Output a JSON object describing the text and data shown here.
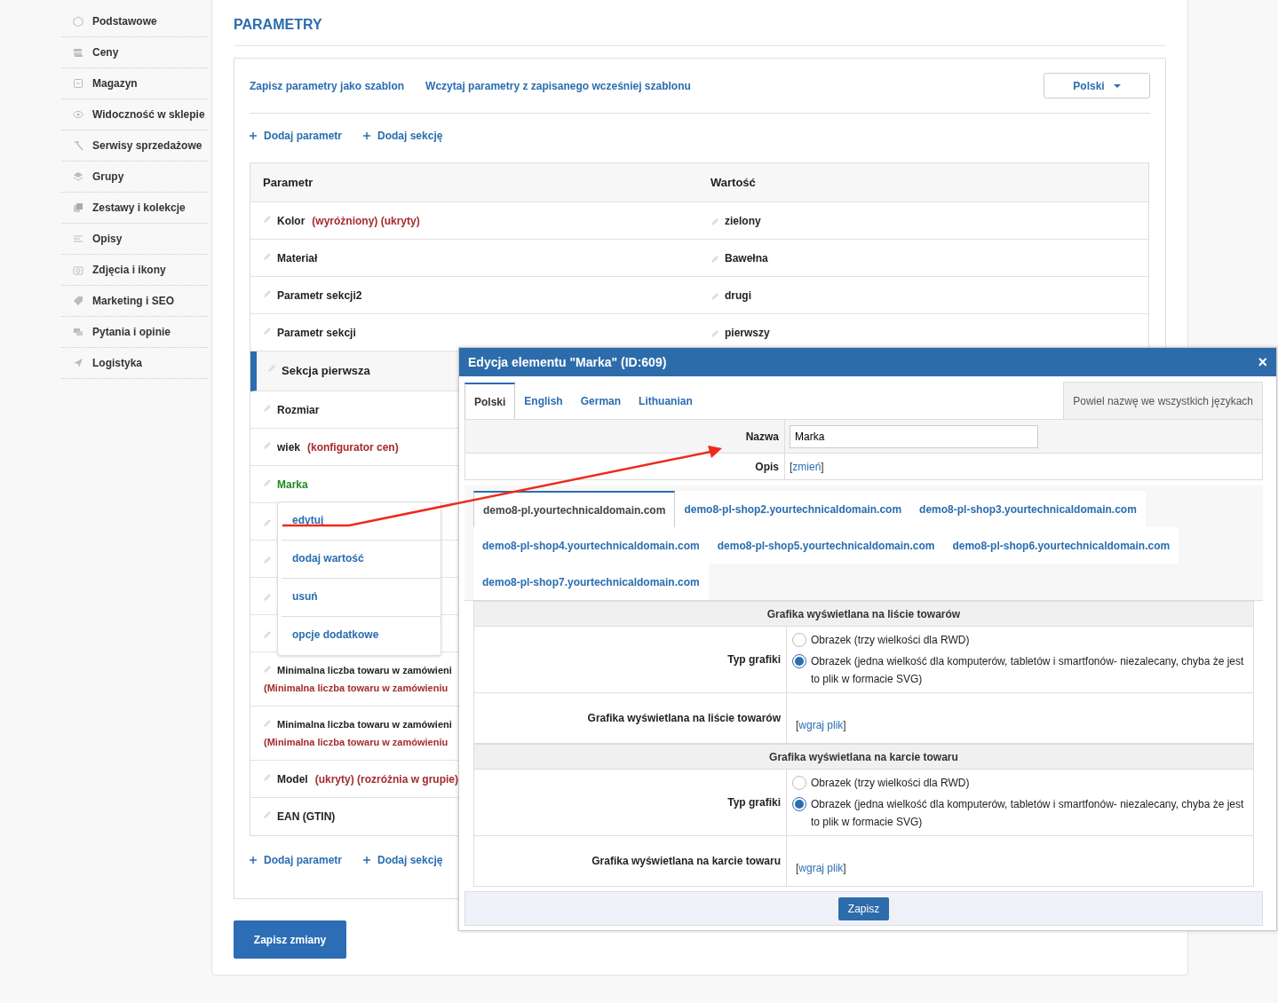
{
  "sidebar": {
    "items": [
      {
        "label": "Podstawowe"
      },
      {
        "label": "Ceny"
      },
      {
        "label": "Magazyn"
      },
      {
        "label": "Widoczność w sklepie"
      },
      {
        "label": "Serwisy sprzedażowe"
      },
      {
        "label": "Grupy"
      },
      {
        "label": "Zestawy i kolekcje"
      },
      {
        "label": "Opisy"
      },
      {
        "label": "Zdjęcia i ikony"
      },
      {
        "label": "Marketing i SEO"
      },
      {
        "label": "Pytania i opinie"
      },
      {
        "label": "Logistyka"
      }
    ]
  },
  "main": {
    "title": "PARAMETRY",
    "template_links": [
      "Zapisz parametry jako szablon",
      "Wczytaj parametry z zapisanego wcześniej szablonu"
    ],
    "language_dropdown": "Polski",
    "add_links_top": [
      "Dodaj parametr",
      "Dodaj sekcję"
    ],
    "table": {
      "columns": [
        "Parametr",
        "Wartość"
      ],
      "rows": [
        {
          "kind": "param",
          "name": "Kolor",
          "tags": "(wyróżniony) (ukryty)",
          "value": "zielony",
          "active": false
        },
        {
          "kind": "param",
          "name": "Materiał",
          "value": "Bawełna",
          "active": false
        },
        {
          "kind": "param",
          "name": "Parametr sekcji2",
          "value": "drugi",
          "active": false
        },
        {
          "kind": "param",
          "name": "Parametr sekcji",
          "value": "pierwszy",
          "active": false
        },
        {
          "kind": "section",
          "name": "Sekcja pierwsza"
        },
        {
          "kind": "param",
          "name": "Rozmiar",
          "active": false
        },
        {
          "kind": "param",
          "name": "wiek",
          "tags": "(konfigurator cen)",
          "active": false
        },
        {
          "kind": "param",
          "name": "Marka",
          "active": true
        },
        {
          "kind": "param"
        },
        {
          "kind": "param"
        },
        {
          "kind": "param"
        },
        {
          "kind": "param"
        },
        {
          "kind": "param",
          "name": "Minimalna liczba towaru w zamówieni",
          "note": "(Minimalna liczba towaru w zamówieniu",
          "active": false
        },
        {
          "kind": "param",
          "name": "Minimalna liczba towaru w zamówieni",
          "note": "(Minimalna liczba towaru w zamówieniu",
          "active": false
        },
        {
          "kind": "param",
          "name": "Model",
          "tags": "(ukryty) (rozróżnia w grupie)",
          "active": false
        },
        {
          "kind": "param",
          "name": "EAN (GTIN)",
          "active": false
        }
      ]
    },
    "add_links_bottom": [
      "Dodaj parametr",
      "Dodaj sekcję"
    ],
    "context_menu": [
      "edytuj",
      "dodaj wartość",
      "usuń",
      "opcje dodatkowe"
    ],
    "save_button": "Zapisz zmiany"
  },
  "modal": {
    "title": "Edycja elementu \"Marka\" (ID:609)",
    "close": "×",
    "language_tabs": [
      {
        "label": "Polski",
        "selected": true
      },
      {
        "label": "English",
        "selected": false
      },
      {
        "label": "German",
        "selected": false
      },
      {
        "label": "Lithuanian",
        "selected": false
      }
    ],
    "copy_button": "Powiel nazwę we wszystkich językach",
    "name_label": "Nazwa",
    "name_value": "Marka",
    "description_label": "Opis",
    "description_link": {
      "before": "[",
      "label": "zmień",
      "after": "]"
    },
    "shop_tabs": [
      {
        "label": "demo8-pl.yourtechnicaldomain.com",
        "selected": true
      },
      {
        "label": "demo8-pl-shop2.yourtechnicaldomain.com",
        "selected": false
      },
      {
        "label": "demo8-pl-shop3.yourtechnicaldomain.com",
        "selected": false
      },
      {
        "label": "demo8-pl-shop4.yourtechnicaldomain.com",
        "selected": false
      },
      {
        "label": "demo8-pl-shop5.yourtechnicaldomain.com",
        "selected": false
      },
      {
        "label": "demo8-pl-shop6.yourtechnicaldomain.com",
        "selected": false
      },
      {
        "label": "demo8-pl-shop7.yourtechnicaldomain.com",
        "selected": false
      }
    ],
    "sections": [
      {
        "heading": "Grafika wyświetlana na liście towarów",
        "type_label": "Typ grafiki",
        "options": [
          {
            "label": "Obrazek (trzy wielkości dla RWD)",
            "selected": false
          },
          {
            "label": "Obrazek (jedna wielkość dla komputerów, tabletów i smartfonów- niezalecany, chyba że jest to plik w formacie SVG)",
            "selected": true
          }
        ],
        "upload_label": "Grafika wyświetlana na liście towarów",
        "upload_link": {
          "before": "[",
          "label": "wgraj plik",
          "after": "]"
        }
      },
      {
        "heading": "Grafika wyświetlana na karcie towaru",
        "type_label": "Typ grafiki",
        "options": [
          {
            "label": "Obrazek (trzy wielkości dla RWD)",
            "selected": false
          },
          {
            "label": "Obrazek (jedna wielkość dla komputerów, tabletów i smartfonów- niezalecany, chyba że jest to plik w formacie SVG)",
            "selected": true
          }
        ],
        "upload_label": "Grafika wyświetlana na karcie towaru",
        "upload_link": {
          "before": "[",
          "label": "wgraj plik",
          "after": "]"
        }
      }
    ],
    "save_button": "Zapisz"
  }
}
